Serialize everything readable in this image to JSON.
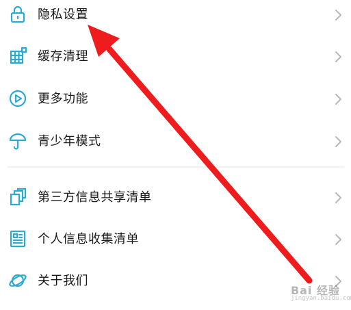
{
  "settings": {
    "items": [
      {
        "label": "隐私设置",
        "icon": "lock-icon"
      },
      {
        "label": "缓存清理",
        "icon": "grid-cleanup-icon"
      },
      {
        "label": "更多功能",
        "icon": "play-circle-icon"
      },
      {
        "label": "青少年模式",
        "icon": "umbrella-icon"
      },
      {
        "label": "第三方信息共享清单",
        "icon": "copy-stack-icon"
      },
      {
        "label": "个人信息收集清单",
        "icon": "document-list-icon"
      },
      {
        "label": "关于我们",
        "icon": "planet-icon"
      }
    ]
  },
  "colors": {
    "icon": "#29a9d3",
    "text": "#1a1a1a",
    "chevron": "#b8b8b8",
    "arrow": "#ee1c1c",
    "divider": "#f2f2f2"
  },
  "watermark": {
    "main": "Bai 经验",
    "sub": "jingyan.baidu.com"
  }
}
